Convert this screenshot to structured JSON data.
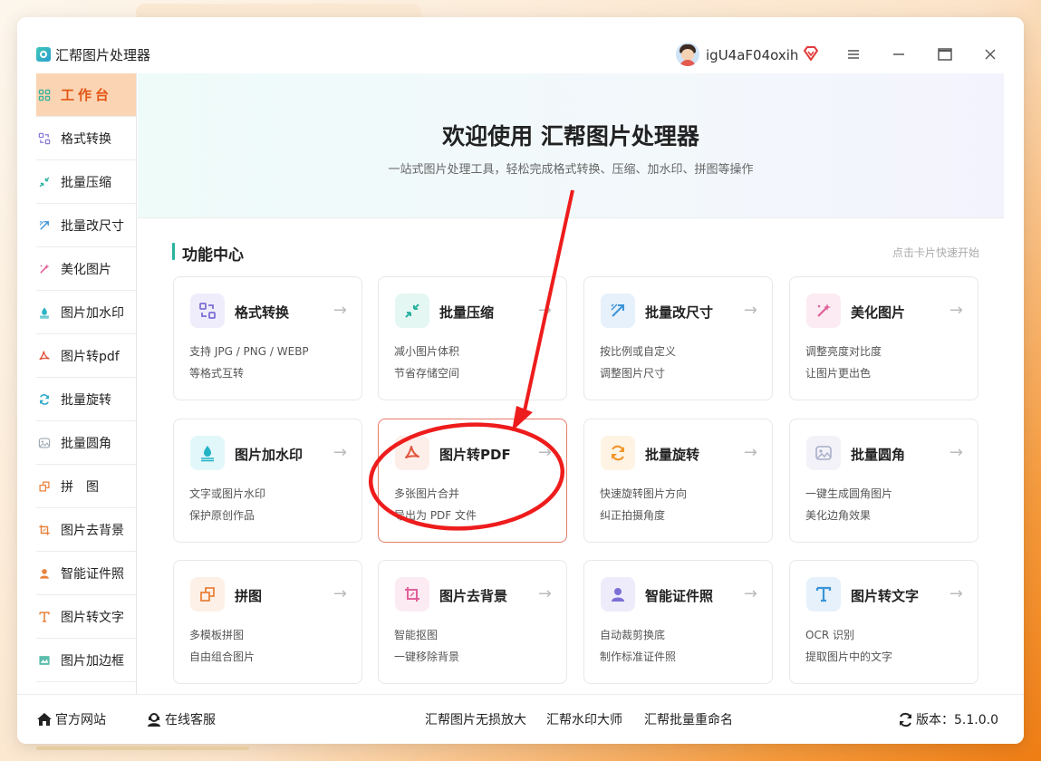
{
  "app": {
    "title": "汇帮图片处理器",
    "username": "igU4aF04oxih"
  },
  "sidebar": {
    "items": [
      {
        "label": "工作台",
        "icon": "grid-icon",
        "color": "#3fb29e",
        "active": true
      },
      {
        "label": "格式转换",
        "icon": "convert-icon",
        "color": "#8a7bd8"
      },
      {
        "label": "批量压缩",
        "icon": "compress-icon",
        "color": "#2bb3a0"
      },
      {
        "label": "批量改尺寸",
        "icon": "resize-icon",
        "color": "#3c94d8"
      },
      {
        "label": "美化图片",
        "icon": "beautify-icon",
        "color": "#e0609a"
      },
      {
        "label": "图片加水印",
        "icon": "watermark-icon",
        "color": "#2bb3c4"
      },
      {
        "label": "图片转pdf",
        "icon": "pdf-icon",
        "color": "#e2553f"
      },
      {
        "label": "批量旋转",
        "icon": "rotate-icon",
        "color": "#29a7c9"
      },
      {
        "label": "批量圆角",
        "icon": "round-corner-icon",
        "color": "#9aa6b2"
      },
      {
        "label": "拼　图",
        "icon": "collage-icon",
        "color": "#e8823c"
      },
      {
        "label": "图片去背景",
        "icon": "remove-bg-icon",
        "color": "#e8823c"
      },
      {
        "label": "智能证件照",
        "icon": "id-photo-icon",
        "color": "#e8823c"
      },
      {
        "label": "图片转文字",
        "icon": "text-icon",
        "color": "#e8823c"
      },
      {
        "label": "图片加边框",
        "icon": "border-icon",
        "color": "#3fb29e"
      }
    ]
  },
  "hero": {
    "title": "欢迎使用 汇帮图片处理器",
    "subtitle": "一站式图片处理工具，轻松完成格式转换、压缩、加水印、拼图等操作"
  },
  "section": {
    "title": "功能中心",
    "hint": "点击卡片快速开始"
  },
  "cards": [
    {
      "title": "格式转换",
      "d1": "支持 JPG / PNG / WEBP",
      "d2": "等格式互转",
      "icon": "convert-icon",
      "bg": "#efedfb",
      "color": "#7b6fd6"
    },
    {
      "title": "批量压缩",
      "d1": "减小图片体积",
      "d2": "节省存储空间",
      "icon": "compress-icon",
      "bg": "#e4f7f3",
      "color": "#2bb3a0"
    },
    {
      "title": "批量改尺寸",
      "d1": "按比例或自定义",
      "d2": "调整图片尺寸",
      "icon": "resize-icon",
      "bg": "#e6f1fb",
      "color": "#3c94d8"
    },
    {
      "title": "美化图片",
      "d1": "调整亮度对比度",
      "d2": "让图片更出色",
      "icon": "beautify-icon",
      "bg": "#fcebf3",
      "color": "#e0609a"
    },
    {
      "title": "图片加水印",
      "d1": "文字或图片水印",
      "d2": "保护原创作品",
      "icon": "watermark-icon",
      "bg": "#e2f7fa",
      "color": "#22b3c4"
    },
    {
      "title": "图片转PDF",
      "d1": "多张图片合并",
      "d2": "导出为 PDF 文件",
      "icon": "pdf-icon",
      "bg": "#fdeeea",
      "color": "#e2553f"
    },
    {
      "title": "批量旋转",
      "d1": "快速旋转图片方向",
      "d2": "纠正拍摄角度",
      "icon": "rotate-icon",
      "bg": "#fff3e4",
      "color": "#f0962b"
    },
    {
      "title": "批量圆角",
      "d1": "一键生成圆角图片",
      "d2": "美化边角效果",
      "icon": "round-corner-icon",
      "bg": "#f2f2f8",
      "color": "#a7aec8"
    },
    {
      "title": "拼图",
      "d1": "多模板拼图",
      "d2": "自由组合图片",
      "icon": "collage-icon",
      "bg": "#fdf0e6",
      "color": "#e8823c"
    },
    {
      "title": "图片去背景",
      "d1": "智能抠图",
      "d2": "一键移除背景",
      "icon": "remove-bg-icon",
      "bg": "#fcebf3",
      "color": "#e0609a"
    },
    {
      "title": "智能证件照",
      "d1": "自动裁剪换底",
      "d2": "制作标准证件照",
      "icon": "id-photo-icon",
      "bg": "#eeecfb",
      "color": "#7b6fd6"
    },
    {
      "title": "图片转文字",
      "d1": "OCR 识别",
      "d2": "提取图片中的文字",
      "icon": "text-icon",
      "bg": "#e6f1fb",
      "color": "#3c94d8"
    }
  ],
  "footer": {
    "official": "官方网站",
    "service": "在线客服",
    "link1": "汇帮图片无损放大",
    "link2": "汇帮水印大师",
    "link3": "汇帮批量重命名",
    "version": "版本：5.1.0.0"
  },
  "colors": {
    "accent": "#e35516",
    "teal": "#2bb3a0",
    "annotation": "#ee1c1c"
  }
}
